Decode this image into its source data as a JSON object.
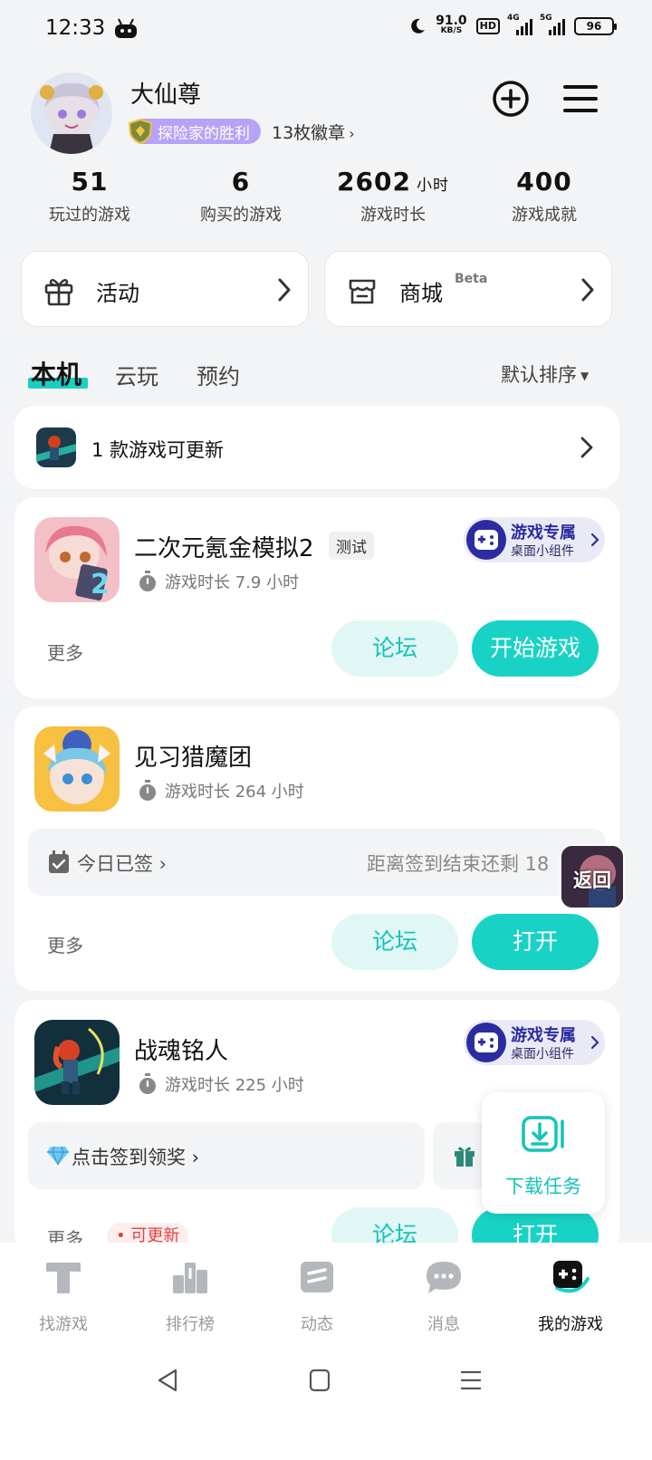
{
  "status_bar": {
    "time": "12:33",
    "net_speed": "91.0",
    "net_unit": "KB/S",
    "hd": "HD",
    "sig1": "4G",
    "sig2": "5G",
    "battery": "96"
  },
  "profile": {
    "username": "大仙尊",
    "badge_name": "探险家的胜利",
    "badge_count": "13枚徽章"
  },
  "stats": [
    {
      "value": "51",
      "unit": "",
      "label": "玩过的游戏"
    },
    {
      "value": "6",
      "unit": "",
      "label": "购买的游戏"
    },
    {
      "value": "2602",
      "unit": "小时",
      "label": "游戏时长"
    },
    {
      "value": "400",
      "unit": "",
      "label": "游戏成就"
    }
  ],
  "quick": {
    "activity_label": "活动",
    "store_label": "商城",
    "store_beta": "Beta"
  },
  "tabs": [
    "本机",
    "云玩",
    "预约"
  ],
  "sort_label": "默认排序",
  "update_banner": {
    "text": "1 款游戏可更新"
  },
  "widget": {
    "title": "游戏专属",
    "subtitle": "桌面小组件"
  },
  "games": [
    {
      "name": "二次元氪金模拟2",
      "tag": "测试",
      "playtime": "游戏时长 7.9 小时",
      "more": "更多",
      "forum": "论坛",
      "action": "开始游戏"
    },
    {
      "name": "见习猎魔团",
      "playtime": "游戏时长 264 小时",
      "signin_status": "今日已签",
      "signin_countdown": "距离签到结束还剩 18",
      "more": "更多",
      "forum": "论坛",
      "action": "打开"
    },
    {
      "name": "战魂铭人",
      "playtime": "游戏时长 225 小时",
      "signin_prompt": "点击签到领奖",
      "more": "更多",
      "update_badge": "可更新",
      "forum": "论坛",
      "action": "打开"
    }
  ],
  "float_return": "返回",
  "download_task": "下载任务",
  "bottom_nav": [
    {
      "label": "找游戏",
      "icon": "find-games-icon"
    },
    {
      "label": "排行榜",
      "icon": "ranking-icon"
    },
    {
      "label": "动态",
      "icon": "feed-icon"
    },
    {
      "label": "消息",
      "icon": "message-icon"
    },
    {
      "label": "我的游戏",
      "icon": "my-games-icon"
    }
  ],
  "colors": {
    "accent": "#18d3c5",
    "badge": "#b7a3f6",
    "widget_text": "#2c2ca0"
  }
}
